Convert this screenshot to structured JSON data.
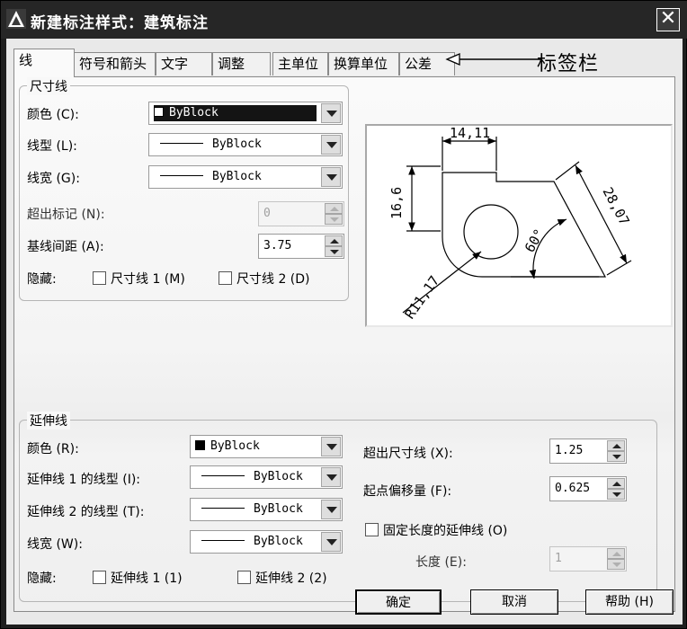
{
  "window": {
    "title": "新建标注样式：建筑标注"
  },
  "tabs": [
    {
      "label": "线"
    },
    {
      "label": "符号和箭头"
    },
    {
      "label": "文字"
    },
    {
      "label": "调整"
    },
    {
      "label": "主单位"
    },
    {
      "label": "换算单位"
    },
    {
      "label": "公差"
    }
  ],
  "annotation": {
    "label": "标签栏"
  },
  "dim_line": {
    "legend": "尺寸线",
    "color_label": "颜色 (C):",
    "color_value": "ByBlock",
    "linetype_label": "线型 (L):",
    "linetype_value": "ByBlock",
    "lineweight_label": "线宽 (G):",
    "lineweight_value": "ByBlock",
    "extend_ticks_label": "超出标记 (N):",
    "extend_ticks_value": "0",
    "baseline_spacing_label": "基线间距 (A):",
    "baseline_spacing_value": "3.75",
    "suppress_label": "隐藏:",
    "suppress_1_label": "尺寸线 1 (M)",
    "suppress_2_label": "尺寸线 2 (D)"
  },
  "preview": {
    "dim_top": "14,11",
    "dim_left": "16,6",
    "dim_right": "28,07",
    "dim_angle": "60°",
    "dim_radius": "R11,17"
  },
  "ext_line": {
    "legend": "延伸线",
    "color_label": "颜色 (R):",
    "color_value": "ByBlock",
    "linetype1_label": "延伸线 1 的线型 (I):",
    "linetype1_value": "ByBlock",
    "linetype2_label": "延伸线 2 的线型 (T):",
    "linetype2_value": "ByBlock",
    "lineweight_label": "线宽 (W):",
    "lineweight_value": "ByBlock",
    "suppress_label": "隐藏:",
    "suppress_1_label": "延伸线 1 (1)",
    "suppress_2_label": "延伸线 2 (2)",
    "extend_beyond_label": "超出尺寸线 (X):",
    "extend_beyond_value": "1.25",
    "offset_label": "起点偏移量 (F):",
    "offset_value": "0.625",
    "fixed_length_label": "固定长度的延伸线 (O)",
    "length_label": "长度 (E):",
    "length_value": "1"
  },
  "buttons": {
    "ok": "确定",
    "cancel": "取消",
    "help": "帮助 (H)"
  }
}
